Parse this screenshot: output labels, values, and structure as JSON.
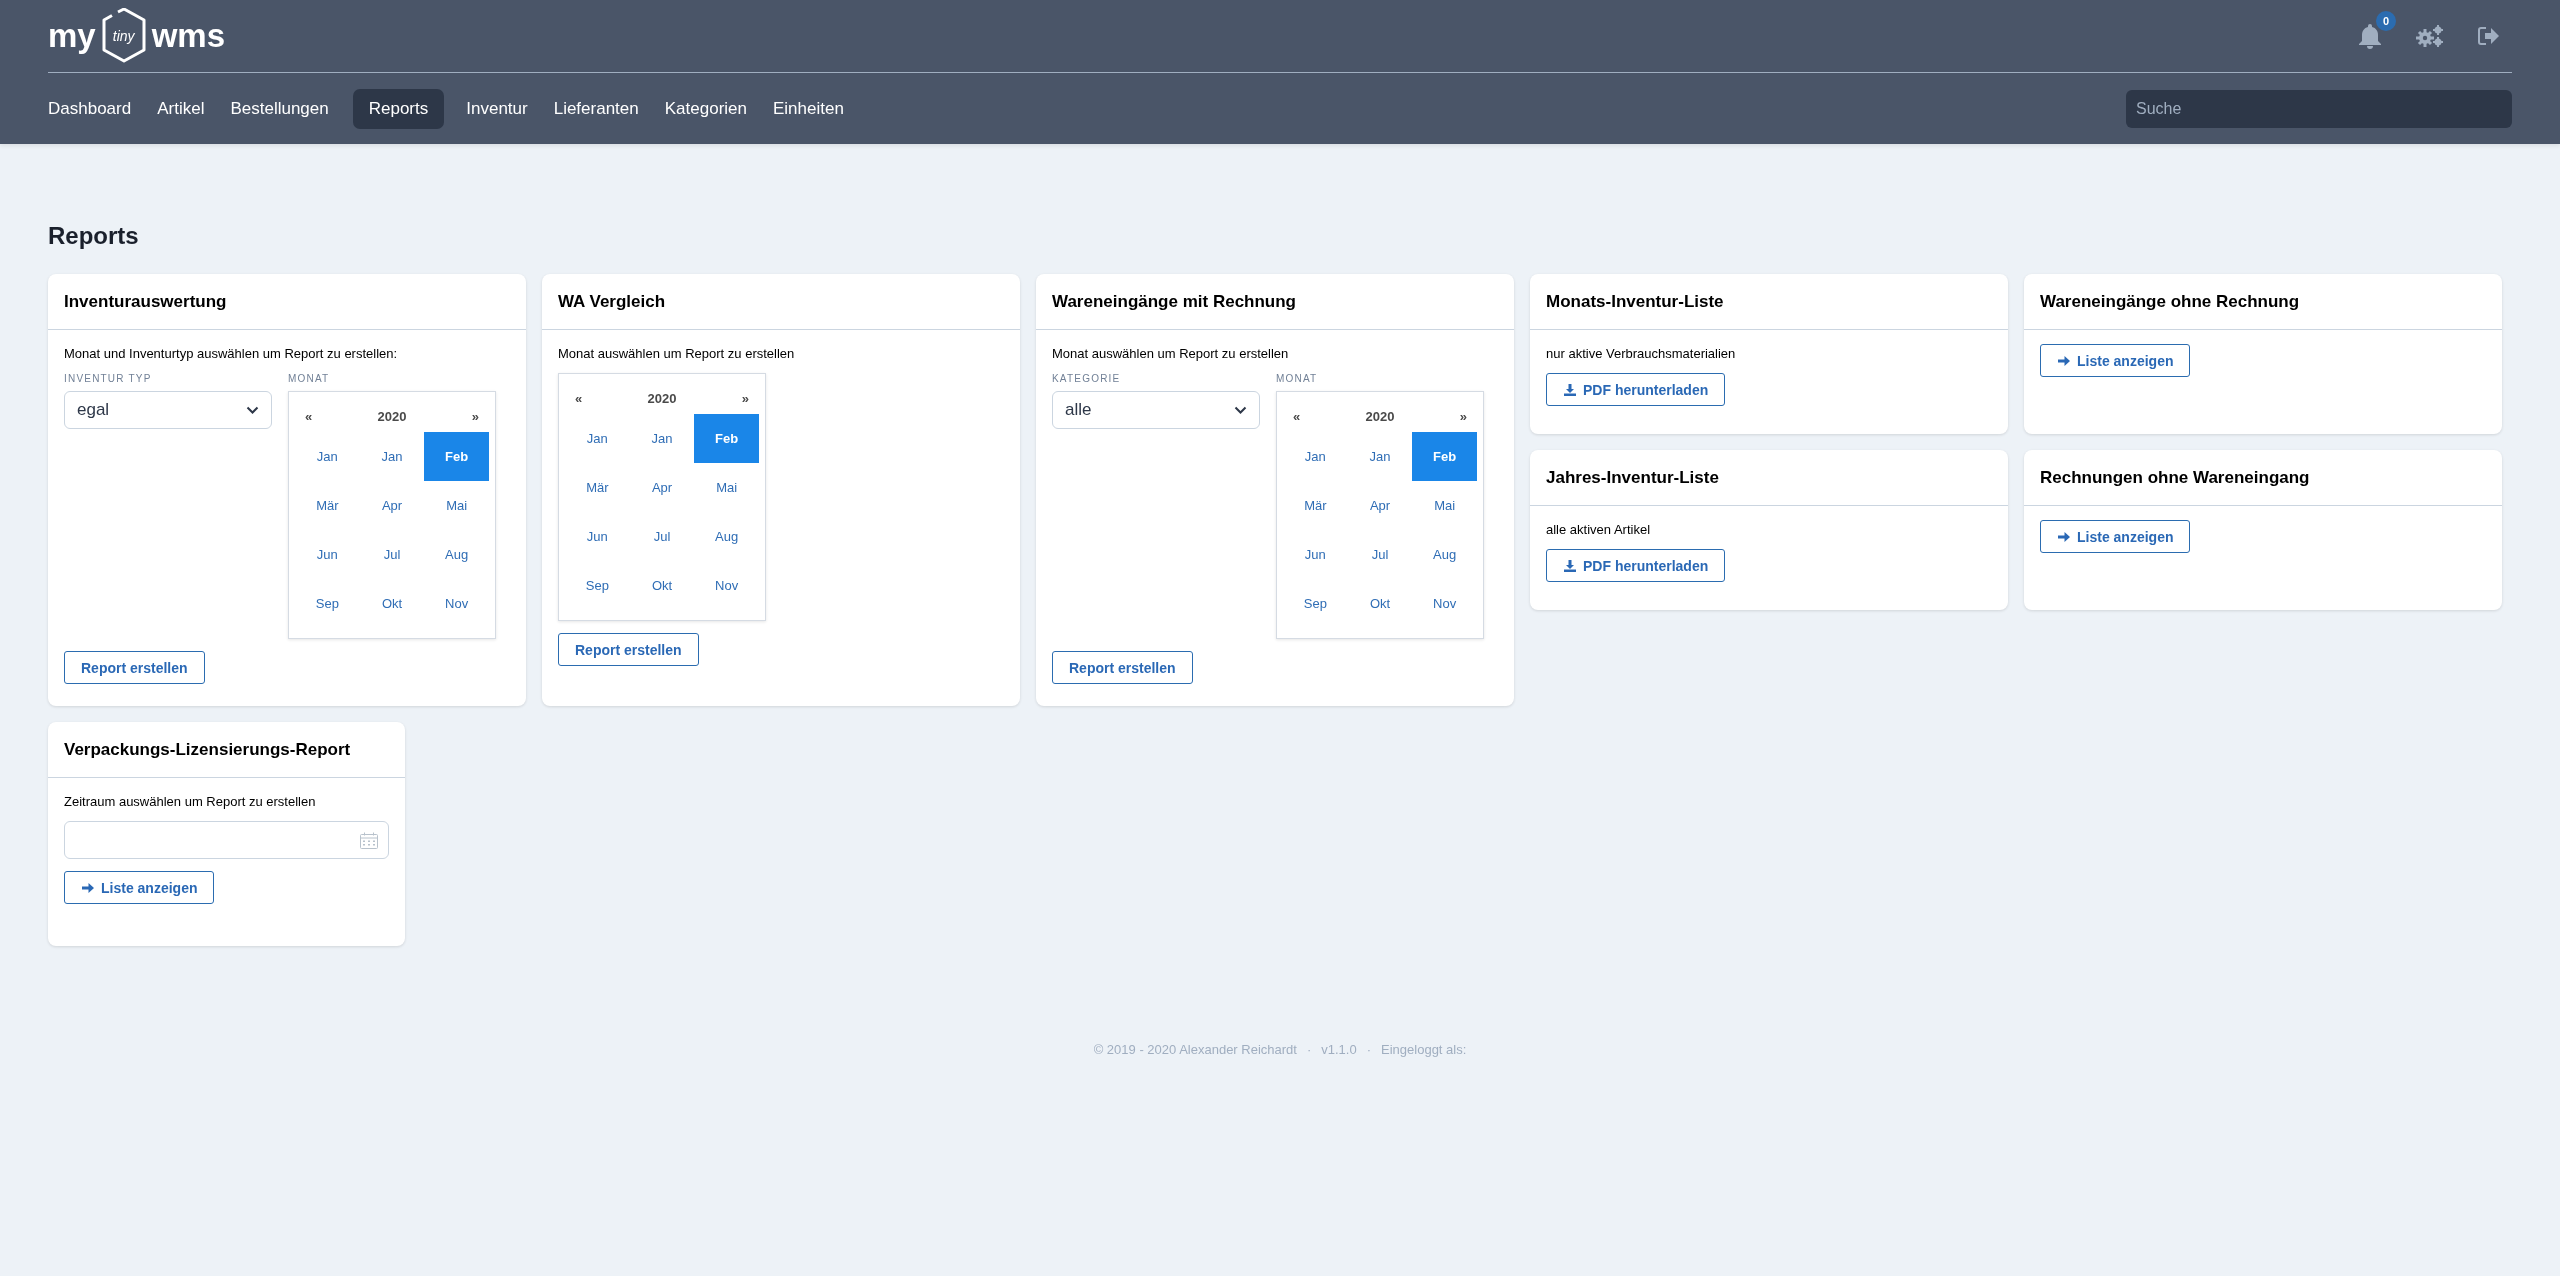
{
  "header": {
    "logo": {
      "left": "my",
      "middle": "tiny",
      "right": "wms"
    },
    "notifications": {
      "count": "0"
    },
    "nav": [
      {
        "label": "Dashboard",
        "selected": false
      },
      {
        "label": "Artikel",
        "selected": false
      },
      {
        "label": "Bestellungen",
        "selected": false
      },
      {
        "label": "Reports",
        "selected": true
      },
      {
        "label": "Inventur",
        "selected": false
      },
      {
        "label": "Lieferanten",
        "selected": false
      },
      {
        "label": "Kategorien",
        "selected": false
      },
      {
        "label": "Einheiten",
        "selected": false
      }
    ],
    "search": {
      "placeholder": "Suche"
    }
  },
  "page": {
    "title": "Reports"
  },
  "columns": [
    {
      "cards": [
        {
          "kind": "month_report",
          "title": "Inventurauswertung",
          "description": "Monat und Inventurtyp auswählen um Report zu erstellen:",
          "select": {
            "label": "INVENTUR TYP",
            "value": "egal"
          },
          "calendar": {
            "label": "MONAT",
            "prev": "«",
            "year": "2020",
            "next": "»",
            "months": [
              {
                "label": "Jan",
                "selected": false
              },
              {
                "label": "Jan",
                "selected": false
              },
              {
                "label": "Feb",
                "selected": true
              },
              {
                "label": "Mär",
                "selected": false
              },
              {
                "label": "Apr",
                "selected": false
              },
              {
                "label": "Mai",
                "selected": false
              },
              {
                "label": "Jun",
                "selected": false
              },
              {
                "label": "Jul",
                "selected": false
              },
              {
                "label": "Aug",
                "selected": false
              },
              {
                "label": "Sep",
                "selected": false
              },
              {
                "label": "Okt",
                "selected": false
              },
              {
                "label": "Nov",
                "selected": false
              }
            ]
          },
          "button": {
            "label": "Report erstellen"
          }
        }
      ]
    },
    {
      "cards": [
        {
          "kind": "month_report",
          "title": "WA Vergleich",
          "description": "Monat auswählen um Report zu erstellen",
          "calendar": {
            "prev": "«",
            "year": "2020",
            "next": "»",
            "months": [
              {
                "label": "Jan",
                "selected": false
              },
              {
                "label": "Jan",
                "selected": false
              },
              {
                "label": "Feb",
                "selected": true
              },
              {
                "label": "Mär",
                "selected": false
              },
              {
                "label": "Apr",
                "selected": false
              },
              {
                "label": "Mai",
                "selected": false
              },
              {
                "label": "Jun",
                "selected": false
              },
              {
                "label": "Jul",
                "selected": false
              },
              {
                "label": "Aug",
                "selected": false
              },
              {
                "label": "Sep",
                "selected": false
              },
              {
                "label": "Okt",
                "selected": false
              },
              {
                "label": "Nov",
                "selected": false
              }
            ]
          },
          "button": {
            "label": "Report erstellen"
          }
        }
      ]
    },
    {
      "cards": [
        {
          "kind": "month_report",
          "title": "Wareneingänge mit Rechnung",
          "description": "Monat auswählen um Report zu erstellen",
          "select": {
            "label": "KATEGORIE",
            "value": "alle"
          },
          "calendar": {
            "label": "MONAT",
            "prev": "«",
            "year": "2020",
            "next": "»",
            "months": [
              {
                "label": "Jan",
                "selected": false
              },
              {
                "label": "Jan",
                "selected": false
              },
              {
                "label": "Feb",
                "selected": true
              },
              {
                "label": "Mär",
                "selected": false
              },
              {
                "label": "Apr",
                "selected": false
              },
              {
                "label": "Mai",
                "selected": false
              },
              {
                "label": "Jun",
                "selected": false
              },
              {
                "label": "Jul",
                "selected": false
              },
              {
                "label": "Aug",
                "selected": false
              },
              {
                "label": "Sep",
                "selected": false
              },
              {
                "label": "Okt",
                "selected": false
              },
              {
                "label": "Nov",
                "selected": false
              }
            ]
          },
          "button": {
            "label": "Report erstellen"
          }
        }
      ]
    },
    {
      "cards": [
        {
          "kind": "download",
          "title": "Monats-Inventur-Liste",
          "description": "nur aktive Verbrauchsmaterialien",
          "button": {
            "label": "PDF herunterladen"
          }
        },
        {
          "kind": "download",
          "title": "Jahres-Inventur-Liste",
          "description": "alle aktiven Artikel",
          "button": {
            "label": "PDF herunterladen"
          }
        }
      ]
    },
    {
      "cards": [
        {
          "kind": "list",
          "title": "Wareneingänge ohne Rechnung",
          "button": {
            "label": "Liste anzeigen"
          }
        },
        {
          "kind": "list",
          "title": "Rechnungen ohne Wareneingang",
          "button": {
            "label": "Liste anzeigen"
          }
        }
      ]
    }
  ],
  "bottom_cards": [
    {
      "kind": "range",
      "title": "Verpackungs-Lizensierungs-Report",
      "description": "Zeitraum auswählen um Report zu erstellen",
      "button": {
        "label": "Liste anzeigen"
      }
    }
  ],
  "footer": {
    "parts": [
      "© 2019 - 2020 Alexander Reichardt",
      "·",
      "v1.1.0",
      "·",
      "Eingeloggt als:"
    ]
  }
}
